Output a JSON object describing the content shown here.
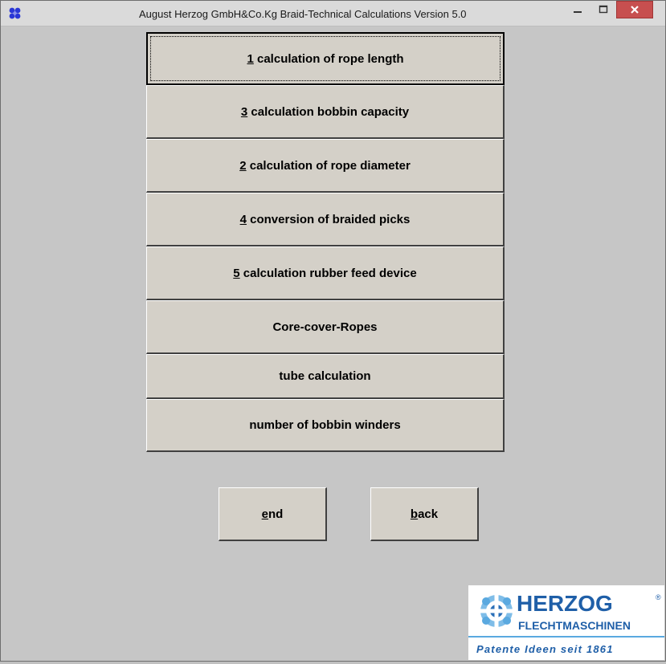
{
  "window": {
    "title": "August Herzog GmbH&Co.Kg Braid-Technical Calculations Version 5.0",
    "controls": {
      "minimize": "minimize",
      "maximize": "maximize",
      "close": "close"
    }
  },
  "menu": {
    "items": [
      {
        "key": "1",
        "label": " calculation of rope length"
      },
      {
        "key": "3",
        "label": " calculation bobbin capacity"
      },
      {
        "key": "2",
        "label": " calculation of rope diameter"
      },
      {
        "key": "4",
        "label": " conversion of braided picks"
      },
      {
        "key": "5",
        "label": " calculation rubber feed device"
      },
      {
        "key": "",
        "label": "Core-cover-Ropes"
      },
      {
        "key": "",
        "label": "tube calculation"
      },
      {
        "key": "",
        "label": "number of bobbin winders"
      }
    ]
  },
  "buttons": {
    "end": {
      "accel": "e",
      "rest": "nd"
    },
    "back": {
      "accel": "b",
      "rest": "ack"
    }
  },
  "logo": {
    "brand": "HERZOG",
    "registered": "®",
    "subtitle": "FLECHTMASCHINEN",
    "slogan": "Patente Ideen seit 1861"
  },
  "colors": {
    "window_bg": "#c6c6c6",
    "button_face": "#d4d0c8",
    "close_button": "#c74f4f",
    "logo_blue": "#1f5fa8",
    "logo_light_blue": "#5aa9e0"
  }
}
